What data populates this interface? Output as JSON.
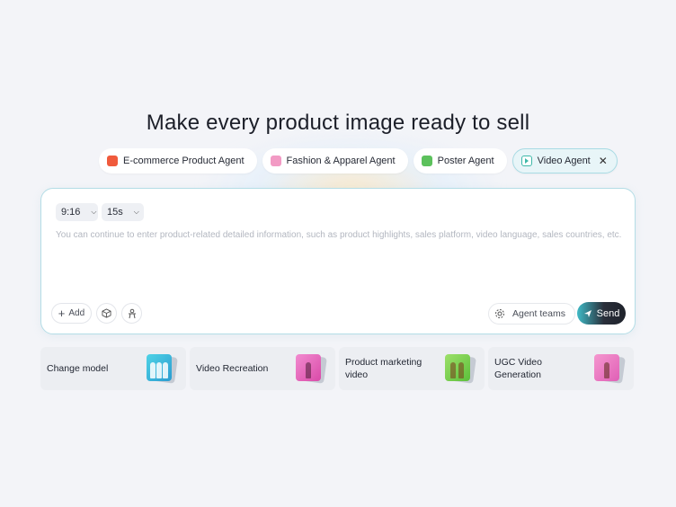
{
  "title": "Make every product image ready to sell",
  "agents": [
    {
      "label": "E-commerce Product Agent",
      "icon": "car-icon",
      "color": "#f05a3c"
    },
    {
      "label": "Fashion & Apparel Agent",
      "icon": "dress-icon",
      "color": "#f29ac4"
    },
    {
      "label": "Poster Agent",
      "icon": "poster-icon",
      "color": "#5cc15c"
    },
    {
      "label": "Video Agent",
      "icon": "video-icon",
      "color": "#3eb8a8",
      "active": true,
      "close": "✕"
    }
  ],
  "composer": {
    "ratio": "9:16",
    "duration": "15s",
    "placeholder": "You can continue to enter product-related detailed information, such as product highlights, sales platform, video language, sales countries, etc.",
    "add_label": "Add",
    "agent_teams_label": "Agent teams",
    "send_label": "Send",
    "accent": "#b4dde6"
  },
  "tasks": [
    {
      "label": "Change model"
    },
    {
      "label": "Video Recreation"
    },
    {
      "label": "Product marketing video"
    },
    {
      "label": "UGC Video Generation"
    }
  ]
}
